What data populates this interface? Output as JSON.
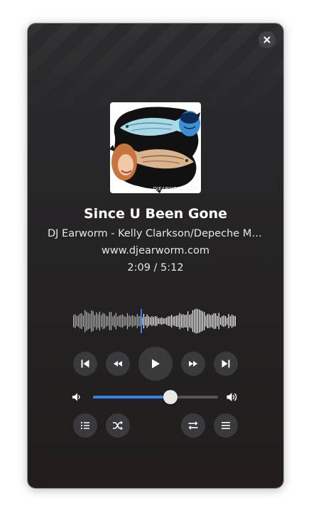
{
  "track": {
    "title": "Since U Been Gone",
    "artist": "DJ Earworm - Kelly Clarkson/Depeche Mo...",
    "album": "www.djearworm.com",
    "time": "2:09 / 5:12",
    "progress_fraction": 0.413
  },
  "cover_art": {
    "watermark": "DJEARWORM.COM"
  },
  "volume": {
    "level_fraction": 0.62
  },
  "colors": {
    "accent": "#3584e4",
    "background": "#252324",
    "button": "#3a3a3c",
    "text": "#ffffff"
  },
  "icons": {
    "close": "close-icon",
    "previous": "skip-previous-icon",
    "rewind": "rewind-icon",
    "play": "play-icon",
    "forward": "fast-forward-icon",
    "next": "skip-next-icon",
    "volume_low": "volume-low-icon",
    "volume_high": "volume-high-icon",
    "playlist": "playlist-icon",
    "shuffle": "shuffle-icon",
    "repeat": "repeat-icon",
    "menu": "menu-icon"
  }
}
